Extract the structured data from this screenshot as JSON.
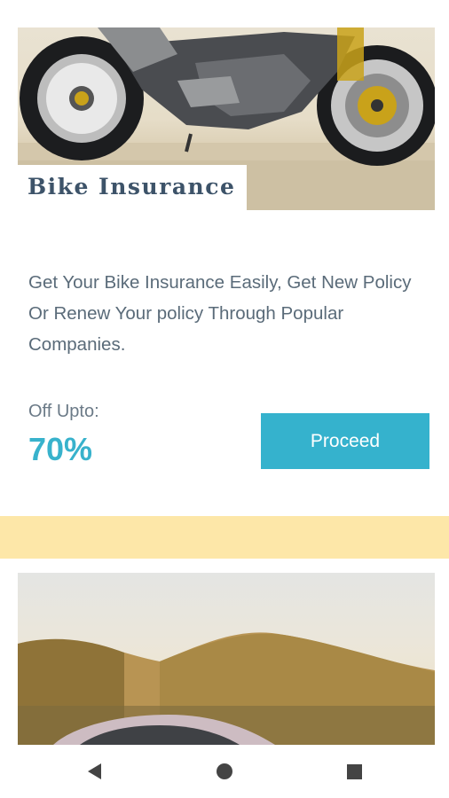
{
  "card": {
    "title": "Bike Insurance",
    "description": "Get Your Bike Insurance Easily, Get New Policy Or Renew Your policy Through Popular Companies.",
    "off_label": "Off Upto:",
    "off_value": "70%",
    "proceed_label": "Proceed"
  },
  "colors": {
    "accent": "#35b2cd",
    "title": "#3d5369",
    "divider": "#fde7a8"
  },
  "nav": {
    "back_icon": "back-triangle-icon",
    "home_icon": "home-circle-icon",
    "recent_icon": "recent-square-icon"
  }
}
